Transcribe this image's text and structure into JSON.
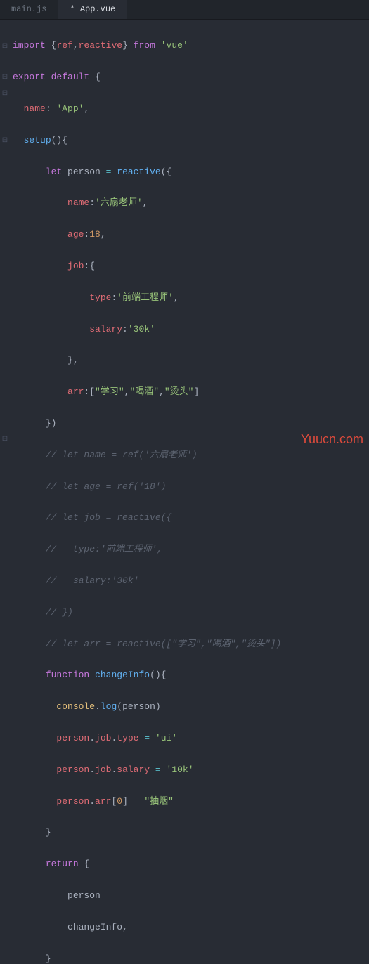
{
  "tabs": [
    {
      "label": "main.js",
      "active": false
    },
    {
      "label": "* App.vue",
      "active": true
    }
  ],
  "watermark": "Yuucn.com",
  "code": {
    "l1_import": "import",
    "l1_ref": "ref",
    "l1_reactive": "reactive",
    "l1_from": "from",
    "l1_vue": "'vue'",
    "l2_export": "export",
    "l2_default": "default",
    "l3_name_key": "name",
    "l3_name_val": "'App'",
    "l4_setup": "setup",
    "l5_let": "let",
    "l5_person": "person",
    "l5_reactive": "reactive",
    "l6_name_key": "name",
    "l6_name_val": "'六扇老师'",
    "l7_age_key": "age",
    "l7_age_val": "18",
    "l8_job_key": "job",
    "l9_type_key": "type",
    "l9_type_val": "'前端工程师'",
    "l10_salary_key": "salary",
    "l10_salary_val": "'30k'",
    "l12_arr_key": "arr",
    "l12_arr_v1": "\"学习\"",
    "l12_arr_v2": "\"喝酒\"",
    "l12_arr_v3": "\"烫头\"",
    "c1": "// let name = ref('六扇老师')",
    "c2": "// let age = ref('18')",
    "c3": "// let job = reactive({",
    "c4": "//   type:'前端工程师',",
    "c5": "//   salary:'30k'",
    "c6": "// })",
    "c7": "// let arr = reactive([\"学习\",\"喝酒\",\"烫头\"])",
    "l21_function": "function",
    "l21_changeInfo": "changeInfo",
    "l22_console": "console",
    "l22_log": "log",
    "l22_person": "person",
    "l23_person": "person",
    "l23_job": "job",
    "l23_type": "type",
    "l23_ui": "'ui'",
    "l24_person": "person",
    "l24_job": "job",
    "l24_salary": "salary",
    "l24_10k": "'10k'",
    "l25_person": "person",
    "l25_arr": "arr",
    "l25_idx": "0",
    "l25_val": "\"抽烟\"",
    "l27_return": "return",
    "l28_person": "person",
    "l29_changeInfo": "changeInfo"
  }
}
